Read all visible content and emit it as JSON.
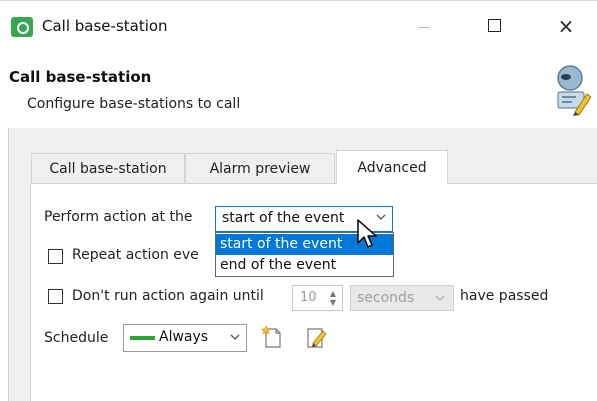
{
  "window": {
    "title": "Call base-station",
    "minimize_label": "—",
    "maximize_label": "",
    "close_label": "×"
  },
  "header": {
    "title": "Call base-station",
    "subtitle": "Configure base-stations to call"
  },
  "tabs": [
    {
      "label": "Call base-station",
      "active": false
    },
    {
      "label": "Alarm preview",
      "active": false
    },
    {
      "label": "Advanced",
      "active": true
    }
  ],
  "advanced": {
    "perform_label": "Perform action at the",
    "perform_value": "start of the event",
    "perform_options": [
      "start of the event",
      "end of the event"
    ],
    "repeat_label": "Repeat action eve",
    "dont_run_label": "Don't run action again until",
    "dont_run_number": "10",
    "dont_run_units": "seconds",
    "have_passed_label": "have passed",
    "schedule_label": "Schedule",
    "schedule_value": "Always",
    "schedule_color": "#25a836"
  },
  "icons": {
    "app": "camera-app-icon",
    "header": "base-station-edit-icon",
    "new_schedule": "new-schedule-icon",
    "edit_schedule": "edit-schedule-icon"
  },
  "accent_color": "#0078d7"
}
